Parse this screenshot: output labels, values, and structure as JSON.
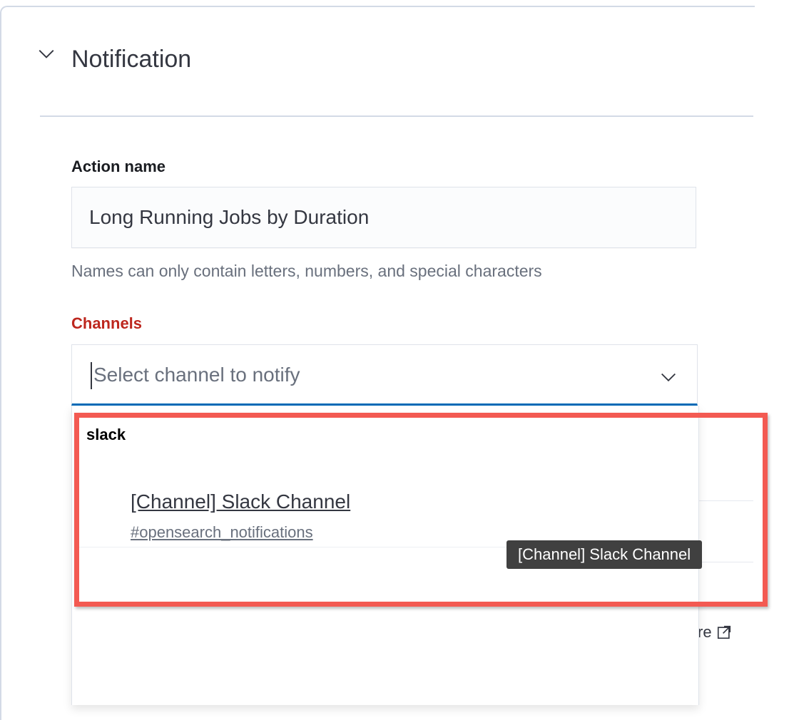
{
  "accordion": {
    "title": "Notification",
    "toggle_icon": "chevron-down-icon"
  },
  "action_name": {
    "label": "Action name",
    "value": "Long Running Jobs by Duration",
    "help_text": "Names can only contain letters, numbers, and special characters"
  },
  "channels": {
    "label": "Channels",
    "placeholder": "Select channel to notify",
    "arrow_icon": "chevron-down-icon",
    "label_color": "#bd271e",
    "focus_color": "#006bb8"
  },
  "dropdown": {
    "groups": [
      {
        "label": "slack",
        "options": [
          {
            "title": "[Channel] Slack Channel",
            "subtitle": "#opensearch_notifications"
          }
        ]
      }
    ]
  },
  "tooltip": {
    "text": "[Channel] Slack Channel"
  },
  "background_link": {
    "text": "re",
    "icon": "external-link-icon"
  },
  "highlight": {
    "color": "#f35a52"
  }
}
